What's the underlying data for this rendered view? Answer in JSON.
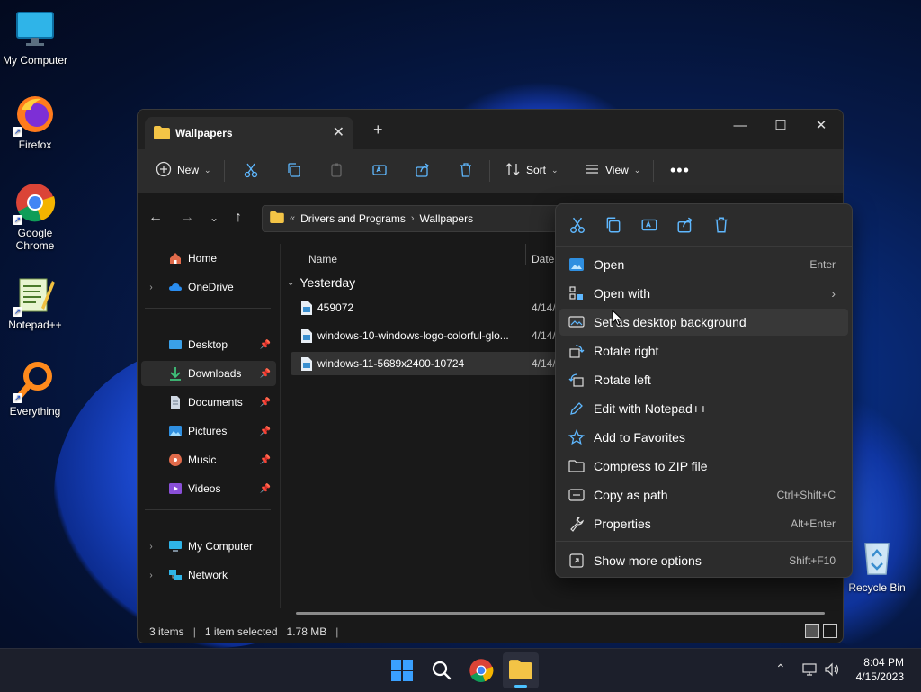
{
  "desktop": {
    "icons": [
      {
        "label": "My Computer"
      },
      {
        "label": "Firefox"
      },
      {
        "label": "Google Chrome"
      },
      {
        "label": "Notepad++"
      },
      {
        "label": "Everything"
      },
      {
        "label": "Recycle Bin"
      }
    ]
  },
  "window": {
    "tab_title": "Wallpapers",
    "toolbar": {
      "new_label": "New",
      "sort_label": "Sort",
      "view_label": "View"
    },
    "address": {
      "overflow": "«",
      "crumbs": [
        "Drivers and Programs",
        "Wallpapers"
      ]
    },
    "sidebar": {
      "items": [
        {
          "label": "Home"
        },
        {
          "label": "OneDrive"
        },
        {
          "label": "Desktop"
        },
        {
          "label": "Downloads"
        },
        {
          "label": "Documents"
        },
        {
          "label": "Pictures"
        },
        {
          "label": "Music"
        },
        {
          "label": "Videos"
        },
        {
          "label": "My Computer"
        },
        {
          "label": "Network"
        }
      ]
    },
    "columns": {
      "name": "Name",
      "date": "Date"
    },
    "group_label": "Yesterday",
    "files": [
      {
        "name": "459072",
        "date": "4/14/"
      },
      {
        "name": "windows-10-windows-logo-colorful-glo...",
        "date": "4/14/"
      },
      {
        "name": "windows-11-5689x2400-10724",
        "date": "4/14/"
      }
    ],
    "status": {
      "items": "3 items",
      "selected": "1 item selected",
      "size": "1.78 MB"
    }
  },
  "context_menu": {
    "items": [
      {
        "label": "Open",
        "shortcut": "Enter"
      },
      {
        "label": "Open with",
        "shortcut": ""
      },
      {
        "label": "Set as desktop background",
        "shortcut": ""
      },
      {
        "label": "Rotate right",
        "shortcut": ""
      },
      {
        "label": "Rotate left",
        "shortcut": ""
      },
      {
        "label": "Edit with Notepad++",
        "shortcut": ""
      },
      {
        "label": "Add to Favorites",
        "shortcut": ""
      },
      {
        "label": "Compress to ZIP file",
        "shortcut": ""
      },
      {
        "label": "Copy as path",
        "shortcut": "Ctrl+Shift+C"
      },
      {
        "label": "Properties",
        "shortcut": "Alt+Enter"
      },
      {
        "label": "Show more options",
        "shortcut": "Shift+F10"
      }
    ]
  },
  "taskbar": {
    "time": "8:04 PM",
    "date": "4/15/2023"
  },
  "colors": {
    "accent": "#4cc2ff",
    "folder": "#f3c446",
    "desktop_bg": "#061a4a"
  }
}
